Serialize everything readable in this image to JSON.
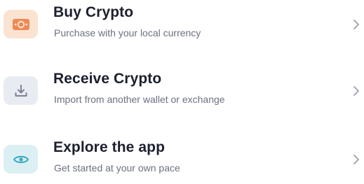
{
  "menu": {
    "items": [
      {
        "title": "Buy Crypto",
        "subtitle": "Purchase with your local currency",
        "icon": "cash-icon",
        "icon_bg": "#fbe3d2",
        "icon_color": "#ee8a55"
      },
      {
        "title": "Receive Crypto",
        "subtitle": "Import from another wallet or exchange",
        "icon": "download-icon",
        "icon_bg": "#e9ebf2",
        "icon_color": "#7d8396"
      },
      {
        "title": "Explore the app",
        "subtitle": "Get started at your own pace",
        "icon": "eye-icon",
        "icon_bg": "#dceff3",
        "icon_color": "#36a9c0"
      }
    ],
    "chevron_icon": "chevron-right-icon",
    "chevron_color": "#9ba0ad"
  }
}
